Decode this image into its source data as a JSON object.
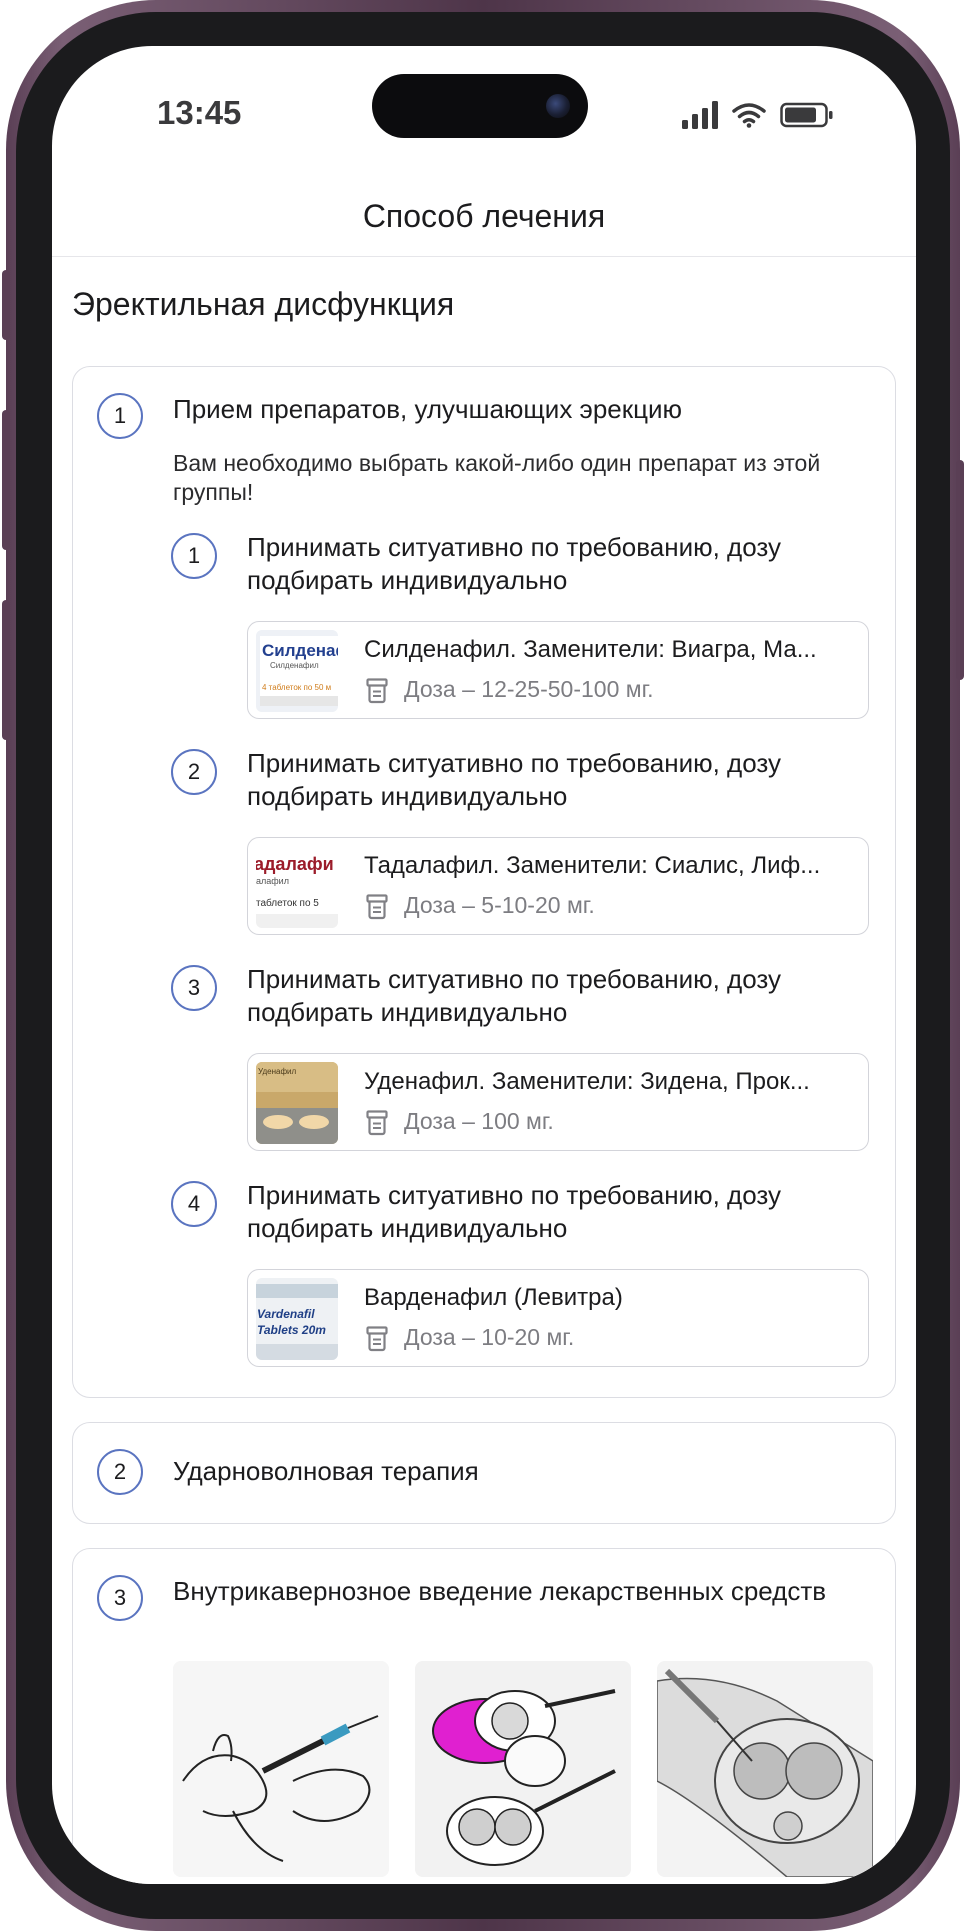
{
  "status_bar": {
    "time": "13:45"
  },
  "header": {
    "title": "Способ лечения"
  },
  "section": {
    "title": "Эректильная дисфункция"
  },
  "cards": [
    {
      "number": "1",
      "title": "Прием препаратов, улучшающих эрекцию",
      "note": "Вам необходимо выбрать какой-либо один препарат из этой группы!",
      "options": [
        {
          "number": "1",
          "title": "Принимать ситуативно по требованию, дозу подбирать индивидуально",
          "drug": "Силденафил. Заменители: Виагра, Ма...",
          "dose": "Доза – 12-25-50-100 мг.",
          "thumb_text": [
            "Силденаф",
            "Силденафил",
            "4 таблеток по 50 м"
          ]
        },
        {
          "number": "2",
          "title": "Принимать ситуативно по требованию, дозу подбирать индивидуально",
          "drug": "Тадалафил. Заменители: Сиалис, Лиф...",
          "dose": "Доза – 5-10-20 мг.",
          "thumb_text": [
            "адалафи",
            "алафил",
            "таблеток по 5"
          ]
        },
        {
          "number": "3",
          "title": "Принимать ситуативно по требованию, дозу подбирать индивидуально",
          "drug": "Уденафил. Заменители: Зидена, Прок...",
          "dose": "Доза – 100 мг.",
          "thumb_text": [
            "Уденафил"
          ]
        },
        {
          "number": "4",
          "title": "Принимать ситуативно по требованию, дозу подбирать индивидуально",
          "drug": "Варденафил (Левитра)",
          "dose": "Доза – 10-20 мг.",
          "thumb_text": [
            "Vardenafil",
            "Tablets 20m"
          ]
        }
      ]
    },
    {
      "number": "2",
      "title": "Ударноволновая терапия"
    },
    {
      "number": "3",
      "title": "Внутрикавернозное введение лекарственных средств"
    }
  ],
  "colors": {
    "accent": "#5a74c0",
    "card_border": "#dcdde3",
    "dose_text": "#7d7d82",
    "frame": "#5a3f55",
    "bezel": "#1b1b1d"
  },
  "icons": [
    "signal-icon",
    "wifi-icon",
    "battery-icon",
    "pill-bottle-icon"
  ]
}
